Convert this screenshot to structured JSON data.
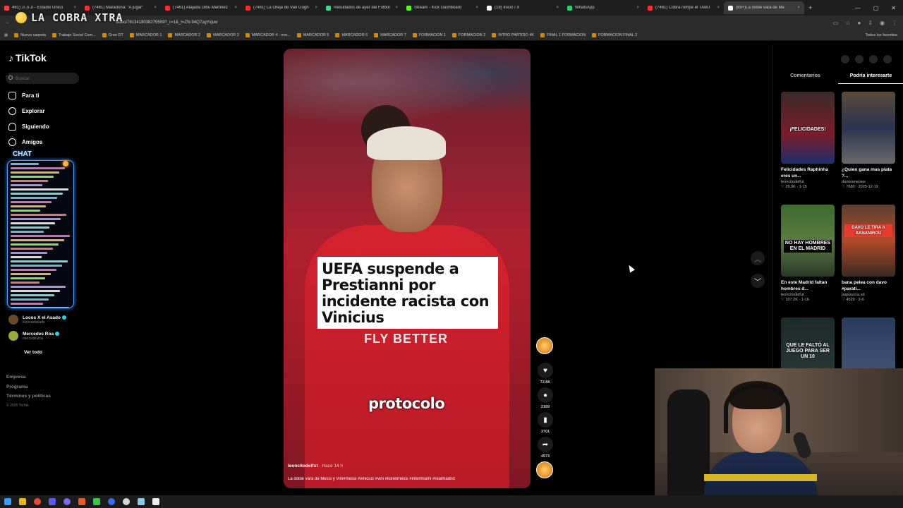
{
  "browser": {
    "tabs": [
      {
        "title": "461) Ji Ji Ji - Estadio Único",
        "color": "#ff3d3d"
      },
      {
        "title": "(7461) Maradona: \"A jugar\"",
        "color": "#ff2a2a"
      },
      {
        "title": "(7461) Atajada Dibu Martinez",
        "color": "#ff2a2a"
      },
      {
        "title": "(7461) La Oreja de Van Gogh",
        "color": "#ff2a2a"
      },
      {
        "title": "Resultados de ayer del Fútbol",
        "color": "#3ddc84"
      },
      {
        "title": "Stream - Kick Dashboard",
        "color": "#53fc18"
      },
      {
        "title": "(18) Inicio / X",
        "color": "#ffffff"
      },
      {
        "title": "WhatsApp",
        "color": "#25d366"
      },
      {
        "title": "(7461) Cobra rompe el TABÚ",
        "color": "#ff2a2a"
      },
      {
        "title": "(99+)La doble vara de Me",
        "color": "#ffffff"
      }
    ],
    "url": "video/7613419038275509?_r=1&_t=ZN-94Q7ugYvjuw",
    "overlay_brand": "LA COBRA XTRA",
    "bookmarks": [
      "Nueva carpeta",
      "Trabajo Social Com...",
      "Gran DT",
      "MARCADOR 1",
      "MARCADOR 2",
      "MARCADOR 3",
      "MARCADOR 4 - ove...",
      "MARCADOR 5",
      "MARCADOR 6",
      "MARCADOR 7",
      "FORMACION 1",
      "FORMACION 2",
      "INTRO PARTIDO 4K",
      "FINAL 1 FORMACION",
      "FORMACION FINAL 2"
    ],
    "bookmarks_right": "Todos los favoritos"
  },
  "sidebar": {
    "logo": "TikTok",
    "search_placeholder": "Buscar",
    "nav": [
      "Para ti",
      "Explorar",
      "Siguiendo",
      "Amigos"
    ],
    "chat_label": "CHAT",
    "following": [
      {
        "name": "Locos X el Asado",
        "handle": "locosxelasado"
      },
      {
        "name": "Mercedes Roa",
        "handle": "mercedesroa"
      }
    ],
    "see_all": "Ver todo",
    "footer": [
      "Empresa",
      "Programa",
      "Términos y políticas"
    ],
    "copyright": "© 2026 TikTok"
  },
  "video": {
    "headline": "UEFA suspende a Prestianni por incidente racista con Vinicius",
    "jersey_text": "FLY BETTER",
    "caption_word": "protocolo",
    "author": "leoncitodelfut",
    "time": "· Hace 14 h",
    "description": "La doble vara de Messi y Vini#messi #vinicius #vini #lionelmessi #intermiami #realmadrid",
    "likes": "72.8K",
    "comments": "2169",
    "saves": "3701",
    "shares": "4973"
  },
  "right_panel": {
    "tabs": [
      "Comentarios",
      "Podría interesarte"
    ],
    "cards": [
      {
        "title": "Felicidades Raphinha eres un...",
        "author": "leoncitodelfut",
        "meta": "♡ 29.9K · 1-15",
        "overlay": "¡FELICIDADES!"
      },
      {
        "title": "¿Quien gana mas plata ?...",
        "author": "davoxeneizee",
        "meta": "♡ 7680 · 2025-12-19",
        "overlay": ""
      },
      {
        "title": "En este Madrid faltan hombres d...",
        "author": "leoncitodelfut",
        "meta": "♡ 107.2K · 1-16",
        "overlay": "NO HAY HOMBRES EN EL MADRID"
      },
      {
        "title": "bana pelea con davo #parati...",
        "author": "papulucca.xd",
        "meta": "♡ 4529 · 2-6",
        "overlay": "DAVO LE TIRA A BANANIROU"
      },
      {
        "title": "",
        "author": "",
        "meta": "",
        "overlay": "QUE LE FALTÓ AL JUEGO PARA SER UN 10"
      },
      {
        "title": "",
        "author": "",
        "meta": "",
        "overlay": ""
      }
    ]
  },
  "colors": {
    "accent": "#fe2c55",
    "chat_glow": "#2e7fff",
    "verified": "#20d5ec"
  }
}
